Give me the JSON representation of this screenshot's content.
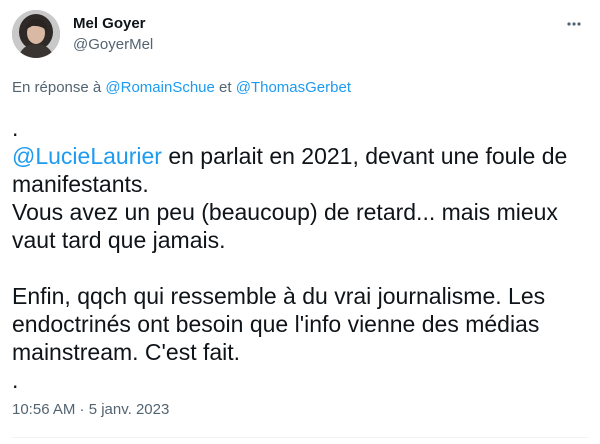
{
  "author": {
    "display_name": "Mel Goyer",
    "handle": "@GoyerMel",
    "avatar_icon": "profile-photo"
  },
  "more_icon": "more-dots-icon",
  "reply_context": {
    "prefix": "En réponse à",
    "mention_1": "@RomainSchue",
    "separator": "et",
    "mention_2": "@ThomasGerbet"
  },
  "body": {
    "line_1": ".",
    "mention": "@LucieLaurier",
    "line_2_rest": " en parlait en 2021, devant une foule de",
    "line_3": "manifestants.",
    "line_4": "Vous avez un peu (beaucoup) de retard... mais mieux",
    "line_5": "vaut tard que jamais.",
    "line_6": "Enfin, qqch qui ressemble à du vrai journalisme. Les",
    "line_7": "endoctrinés ont besoin que l'info vienne des médias",
    "line_8": "mainstream. C'est fait.",
    "line_9": "."
  },
  "timestamp": "10:56 AM · 5 janv. 2023",
  "colors": {
    "link": "#1d9bf0",
    "secondary_text": "#536471",
    "primary_text": "#0f1419"
  }
}
